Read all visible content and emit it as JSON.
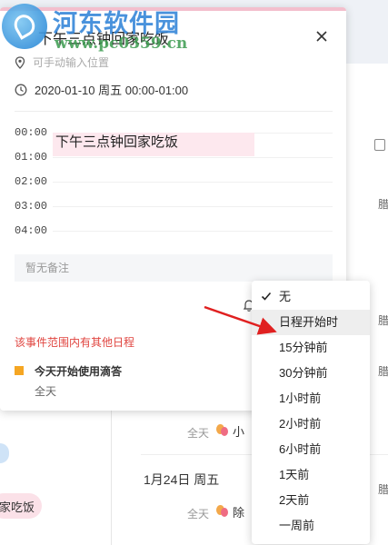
{
  "watermark": {
    "title": "河东软件园",
    "url": "www.pc0359.cn"
  },
  "background": {
    "allday_label": "全天",
    "event_fragment_1": "小",
    "event_fragment_2": "除",
    "date_heading": "1月24日 周五",
    "pill_text": "家吃饭",
    "side_label": "腊"
  },
  "popup": {
    "title": "下午三点钟回家吃饭",
    "location_placeholder": "可手动输入位置",
    "time_range": "2020-01-10 周五 00:00-01:00",
    "hours": [
      "00:00",
      "01:00",
      "02:00",
      "03:00",
      "04:00"
    ],
    "event_block_title": "下午三点钟回家吃饭",
    "notes_placeholder": "暂无备注",
    "conflict_warning": "该事件范围内有其他日程",
    "other_event": {
      "title": "今天开始使用滴答",
      "subtitle": "全天"
    }
  },
  "reminder_menu": {
    "selected": "无",
    "hovered": "日程开始时",
    "options": [
      "无",
      "日程开始时",
      "15分钟前",
      "30分钟前",
      "1小时前",
      "2小时前",
      "6小时前",
      "1天前",
      "2天前",
      "一周前"
    ]
  },
  "colors": {
    "accent_pink": "#fde8ee",
    "warning_red": "#e0443f",
    "other_event_marker": "#f5a623",
    "arrow_red": "#e02020"
  }
}
